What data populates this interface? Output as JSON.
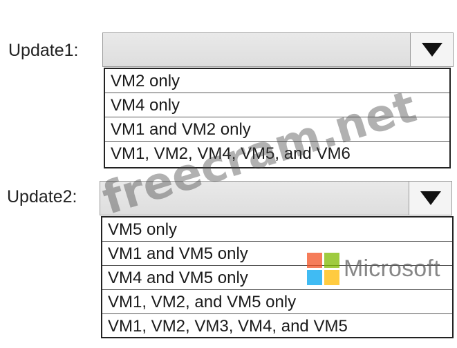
{
  "update1": {
    "label": "Update1:",
    "options": [
      "VM2 only",
      "VM4 only",
      "VM1 and VM2 only",
      "VM1, VM2, VM4, VM5, and VM6"
    ]
  },
  "update2": {
    "label": "Update2:",
    "options": [
      "VM5 only",
      "VM1 and VM5 only",
      "VM4 and VM5 only",
      "VM1, VM2, and VM5 only",
      "VM1, VM2, VM3, VM4, and VM5"
    ]
  },
  "watermark": "freecram.net",
  "logo": {
    "text": "Microsoft",
    "colors": [
      "#f25022",
      "#7fba00",
      "#00a4ef",
      "#ffb900"
    ]
  },
  "icons": {
    "dropdown": "triangle-down-icon"
  }
}
